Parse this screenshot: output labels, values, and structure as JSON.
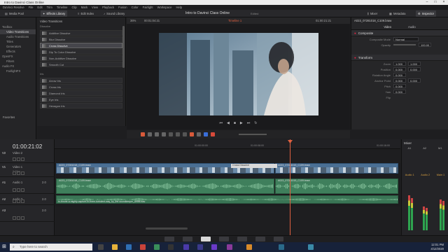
{
  "window": {
    "title": "Intro to Davinci Class Online"
  },
  "menu": [
    "DaVinci Resolve",
    "File",
    "Edit",
    "Trim",
    "Timeline",
    "Clip",
    "Mark",
    "View",
    "Playback",
    "Fusion",
    "Color",
    "Fairlight",
    "Workspace",
    "Help"
  ],
  "topbar": {
    "media_pool": "Media Pool",
    "effects_library": "Effects Library",
    "edit_index": "Edit Index",
    "sound_library": "Sound Library",
    "project_title": "Intro to Davinci Class Online",
    "edited": "Edited",
    "mixer": "Mixer",
    "metadata": "Metadata",
    "inspector": "Inspector"
  },
  "toolbox": {
    "items": [
      "Toolbox",
      "Video Transitions",
      "Audio Transitions",
      "Titles",
      "Generators",
      "Effects",
      "OpenFX",
      "Filters",
      "Audio FX",
      "FairlightFX"
    ],
    "favorites": "Favorites"
  },
  "effects": {
    "header": "Video Transitions",
    "group1": "Dissolve",
    "items1": [
      "Additive Dissolve",
      "Blur Dissolve",
      "Cross Dissolve",
      "Dip To Color Dissolve",
      "Non-Additive Dissolve",
      "Smooth Cut"
    ],
    "group2": "Iris",
    "items2": [
      "Arrow Iris",
      "Cross Iris",
      "Diamond Iris",
      "Eye Iris",
      "Hexagon Iris"
    ]
  },
  "viewer": {
    "zoom": "36%",
    "src_tc": "00:01:04:21",
    "timeline_name": "Timeline 1",
    "rec_tc": "01:00:21:21"
  },
  "inspector": {
    "clip_name": "A023_07281018_C109.braw",
    "tabs": [
      "Video",
      "Audio"
    ],
    "composite": {
      "title": "Composite",
      "mode_label": "Composite Mode",
      "mode_value": "Normal",
      "opacity_label": "Opacity",
      "opacity_value": "100.00"
    },
    "transform": {
      "title": "Transform",
      "zoom_label": "Zoom",
      "zoom_x": "1.000",
      "zoom_y": "1.000",
      "position_label": "Position",
      "position_x": "0.000",
      "position_y": "0.000",
      "rotation_label": "Rotation Angle",
      "rotation": "0.000",
      "anchor_label": "Anchor Point",
      "anchor_x": "0.000",
      "anchor_y": "0.000",
      "pitch_label": "Pitch",
      "pitch": "0.000",
      "yaw_label": "Yaw",
      "yaw": "0.000",
      "flip_label": "Flip"
    }
  },
  "timeline": {
    "timecode": "01:00:21:02",
    "ruler": [
      "01:00:00:00",
      "01:00:08:00",
      "01:00:16:00"
    ],
    "tracks": [
      {
        "id": "V2",
        "name": "Video 2",
        "clips": ""
      },
      {
        "id": "V1",
        "name": "Video 1",
        "clips": "2 Clips"
      },
      {
        "id": "A1",
        "name": "Audio 1",
        "level": "2.0"
      },
      {
        "id": "A2",
        "name": "Audio 2",
        "level": "2.0"
      },
      {
        "id": "A3",
        "name": "",
        "level": "2.0"
      }
    ],
    "clips": {
      "v1a": "A023_07281018_C109.braw",
      "v1b": "A023_07281015_C109.braw",
      "transition": "Cross Dissolve",
      "a1a": "A023_07281018_C109.braw",
      "a1b": "A023_07281015_C109.braw",
      "a2": "to-throne-a-mighty-capture-in-three-turbulent-way_by_the-soundkeeper_Artlist.wav"
    }
  },
  "mixer": {
    "title": "Mixer",
    "channels": [
      "A1",
      "A2",
      "M1"
    ],
    "labels": [
      "Audio 1",
      "Audio 2",
      "Main 1"
    ]
  },
  "pages": [
    "Media",
    "Cut",
    "Edit",
    "Fusion",
    "Color",
    "Fairlight",
    "Deliver"
  ],
  "taskbar": {
    "search_placeholder": "Type here to search",
    "time": "12:01 PM",
    "date": "4/12/2020"
  }
}
